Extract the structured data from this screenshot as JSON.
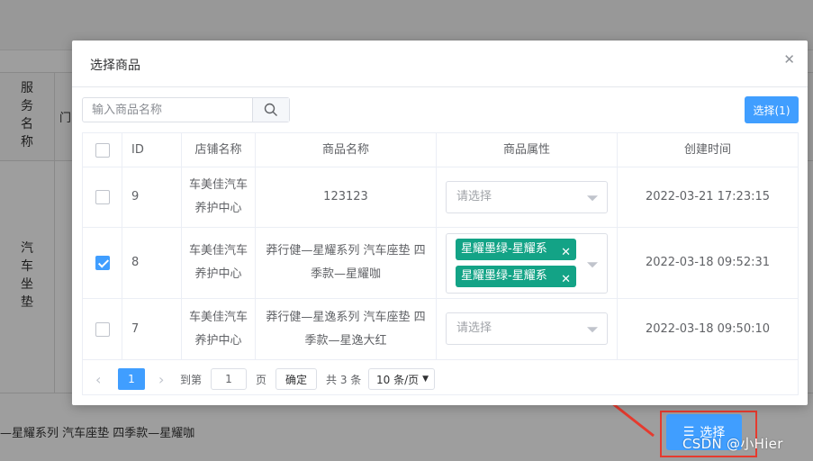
{
  "background": {
    "service_name_label": [
      "服",
      "务",
      "名",
      "称"
    ],
    "partial_text": "门",
    "row_service_value": [
      "汽",
      "车",
      "坐",
      "垫"
    ],
    "bottom_text": "—星耀系列 汽车座垫 四季款—星耀咖",
    "select_button": "选择"
  },
  "dialog": {
    "title": "选择商品",
    "search": {
      "placeholder": "输入商品名称",
      "value": ""
    },
    "select_button": "选择(1)",
    "table": {
      "headers": [
        "ID",
        "店铺名称",
        "商品名称",
        "商品属性",
        "创建时间"
      ],
      "rows": [
        {
          "checked": false,
          "id": "9",
          "shop": [
            "车美佳汽车",
            "养护中心"
          ],
          "product": [
            "123123"
          ],
          "attr_placeholder": "请选择",
          "tags": [],
          "created": "2022-03-21 17:23:15"
        },
        {
          "checked": true,
          "id": "8",
          "shop": [
            "车美佳汽车",
            "养护中心"
          ],
          "product": [
            "莽行健—星耀系列 汽车座垫 四",
            "季款—星耀咖"
          ],
          "attr_placeholder": "",
          "tags": [
            "星耀墨绿-星耀系",
            "星耀墨绿-星耀系"
          ],
          "created": "2022-03-18 09:52:31"
        },
        {
          "checked": false,
          "id": "7",
          "shop": [
            "车美佳汽车",
            "养护中心"
          ],
          "product": [
            "莽行健—星逸系列 汽车座垫 四",
            "季款—星逸大红"
          ],
          "attr_placeholder": "请选择",
          "tags": [],
          "created": "2022-03-18 09:50:10"
        }
      ]
    },
    "pagination": {
      "current_page": "1",
      "goto_label": "到第",
      "goto_value": "1",
      "page_unit": "页",
      "confirm": "确定",
      "total": "共 3 条",
      "page_size": "10 条/页"
    }
  },
  "watermark": "CSDN @小Hier",
  "colors": {
    "primary": "#409eff",
    "tag": "#13a386",
    "annotation": "#e63a2e"
  }
}
